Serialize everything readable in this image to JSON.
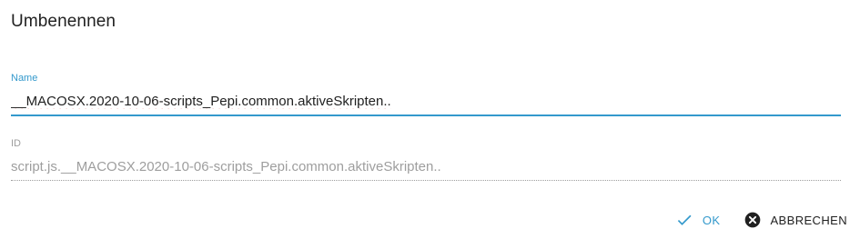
{
  "dialog": {
    "title": "Umbenennen"
  },
  "fields": {
    "name": {
      "label": "Name",
      "value": "__MACOSX.2020-10-06-scripts_Pepi.common.aktiveSkripten.."
    },
    "id": {
      "label": "ID",
      "value": "script.js.__MACOSX.2020-10-06-scripts_Pepi.common.aktiveSkripten.."
    }
  },
  "actions": {
    "ok_label": "OK",
    "cancel_label": "ABBRECHEN",
    "ok_icon": "check-icon",
    "cancel_icon": "close-circle-icon"
  },
  "colors": {
    "accent": "#3399cc",
    "text": "#212121",
    "muted": "#9e9e9e",
    "spellcheck": "#e53935"
  }
}
